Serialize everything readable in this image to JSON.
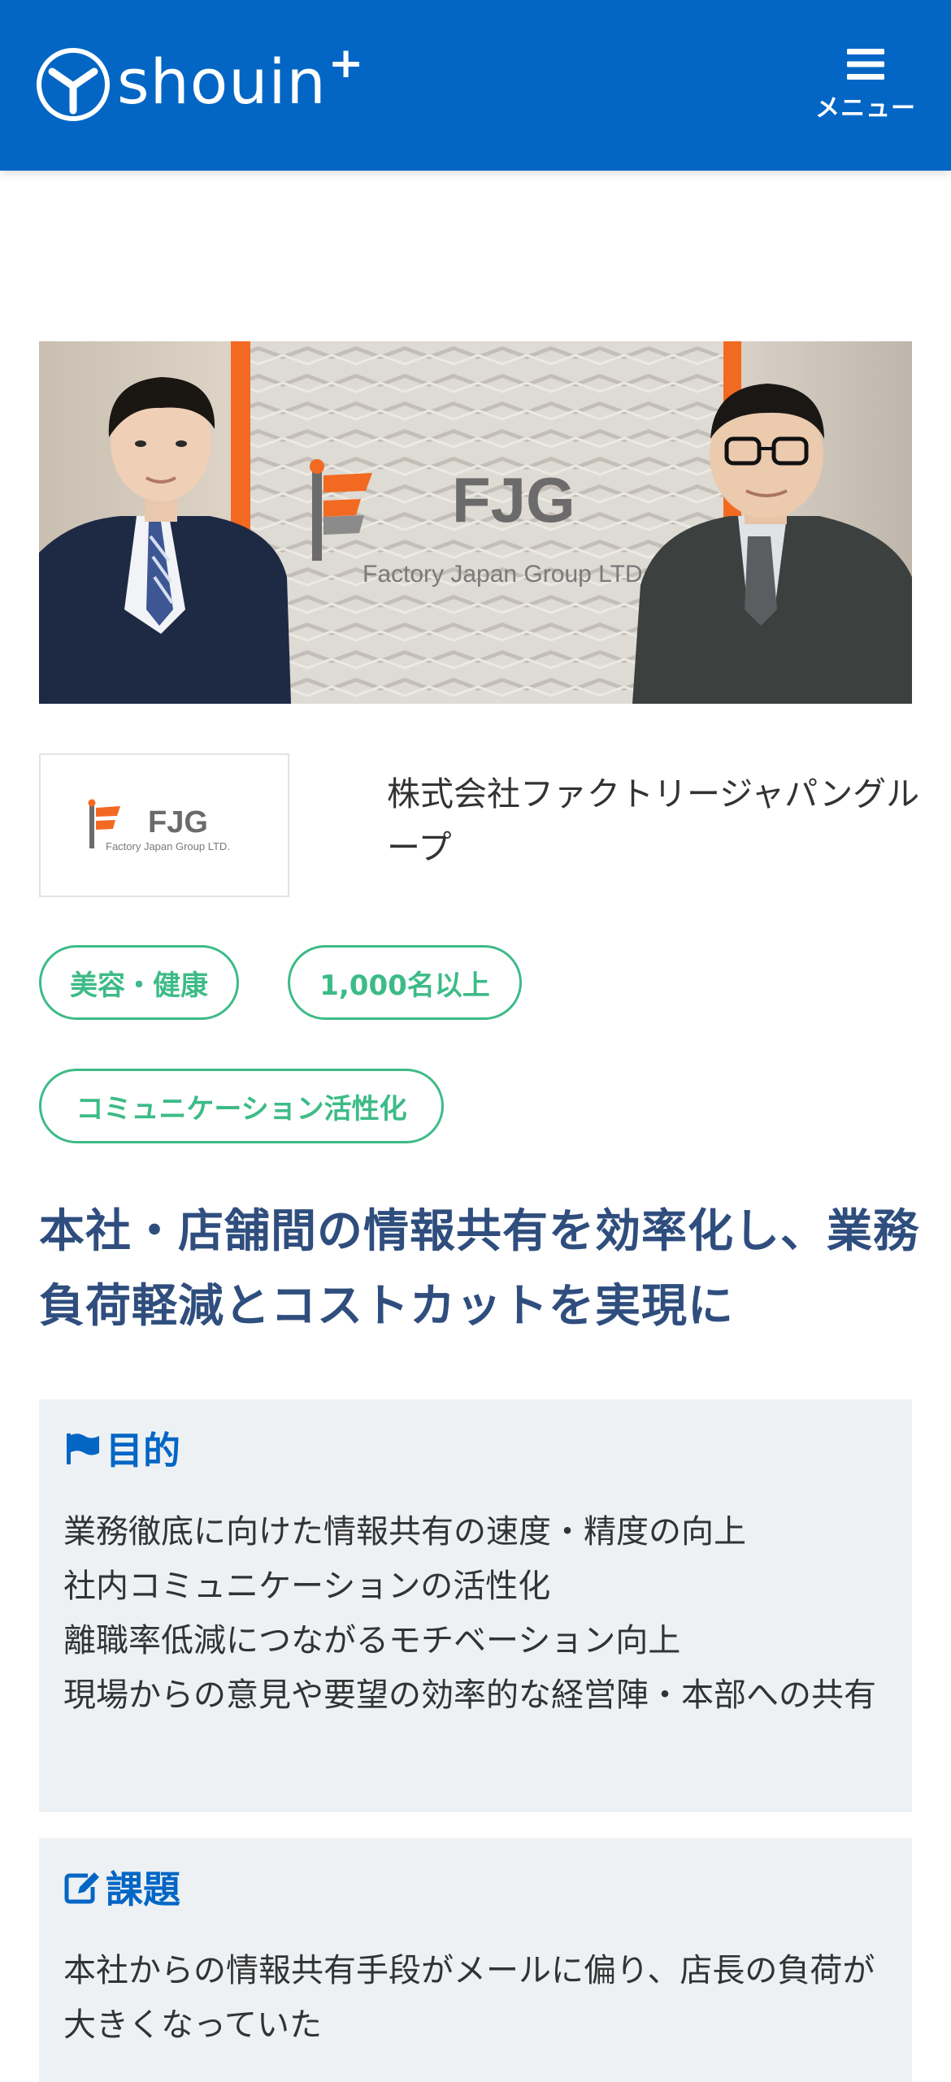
{
  "header": {
    "brand": "shouin",
    "brand_plus": "+",
    "menu_label": "メニュー",
    "logo_icon": "shouin-logo-icon",
    "menu_icon": "hamburger-icon",
    "bg_color": "#0366c5"
  },
  "hero": {
    "logo_letters": "FJG",
    "logo_caption": "Factory Japan Group LTD"
  },
  "company": {
    "logo_letters": "FJG",
    "logo_caption": "Factory Japan Group LTD.",
    "name": "株式会社ファクトリージャパングループ"
  },
  "tags": [
    {
      "label": "美容・健康"
    },
    {
      "label": "1,000名以上"
    },
    {
      "label": "コミュニケーション活性化"
    }
  ],
  "headline": "本社・店舗間の情報共有を効率化し、業務負荷軽減とコストカットを実現に",
  "purpose": {
    "title": "目的",
    "icon": "flag-icon",
    "items": [
      "業務徹底に向けた情報共有の速度・精度の向上",
      "社内コミュニケーションの活性化",
      "離職率低減につながるモチベーション向上",
      "現場からの意見や要望の効率的な経営陣・本部への共有"
    ]
  },
  "issue": {
    "title": "課題",
    "icon": "edit-icon",
    "items": [
      "本社からの情報共有手段がメールに偏り、店長の負荷が大きくなっていた"
    ]
  },
  "colors": {
    "accent": "#0366c5",
    "tag_green": "#3dbb87",
    "headline": "#2f4e7e",
    "box_bg": "#eef1f4"
  }
}
